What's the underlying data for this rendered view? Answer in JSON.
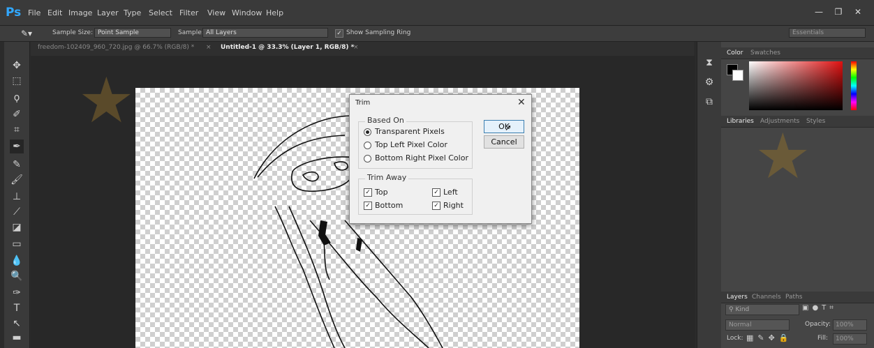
{
  "app": {
    "logo": "Ps"
  },
  "menu": [
    "File",
    "Edit",
    "Image",
    "Layer",
    "Type",
    "Select",
    "Filter",
    "View",
    "Window",
    "Help"
  ],
  "window_controls": {
    "minimize": "—",
    "restore": "❐",
    "close": "✕"
  },
  "options": {
    "sample_size_label": "Sample Size:",
    "sample_size_value": "Point Sample",
    "sample_label": "Sample:",
    "sample_value": "All Layers",
    "show_ring_label": "Show Sampling Ring",
    "workspace": "Essentials"
  },
  "tabs": [
    {
      "label": "freedom-102409_960_720.jpg @ 66.7% (RGB/8) *",
      "close": "×"
    },
    {
      "label": "Untitled-1 @ 33.3% (Layer 1, RGB/8) *",
      "close": "×"
    }
  ],
  "dialog": {
    "title": "Trim",
    "close": "✕",
    "based_on_title": "Based On",
    "options": [
      "Transparent Pixels",
      "Top Left Pixel Color",
      "Bottom Right Pixel Color"
    ],
    "selected_index": 0,
    "trim_away_title": "Trim Away",
    "trim_top": "Top",
    "trim_bottom": "Bottom",
    "trim_left": "Left",
    "trim_right": "Right",
    "ok": "OK",
    "cancel": "Cancel"
  },
  "panels": {
    "color_tabs": [
      "Color",
      "Swatches"
    ],
    "lib_tabs": [
      "Libraries",
      "Adjustments",
      "Styles"
    ],
    "layer_tabs": [
      "Layers",
      "Channels",
      "Paths"
    ],
    "kind_label": "Kind",
    "blend_mode": "Normal",
    "opacity_label": "Opacity:",
    "opacity_value": "100%",
    "lock_label": "Lock:",
    "fill_label": "Fill:",
    "fill_value": "100%"
  },
  "colors": {
    "accent": "#31a8ff",
    "menubar": "#3a3a3a",
    "panel": "#454545",
    "dialog_bg": "#f0f0f0"
  }
}
